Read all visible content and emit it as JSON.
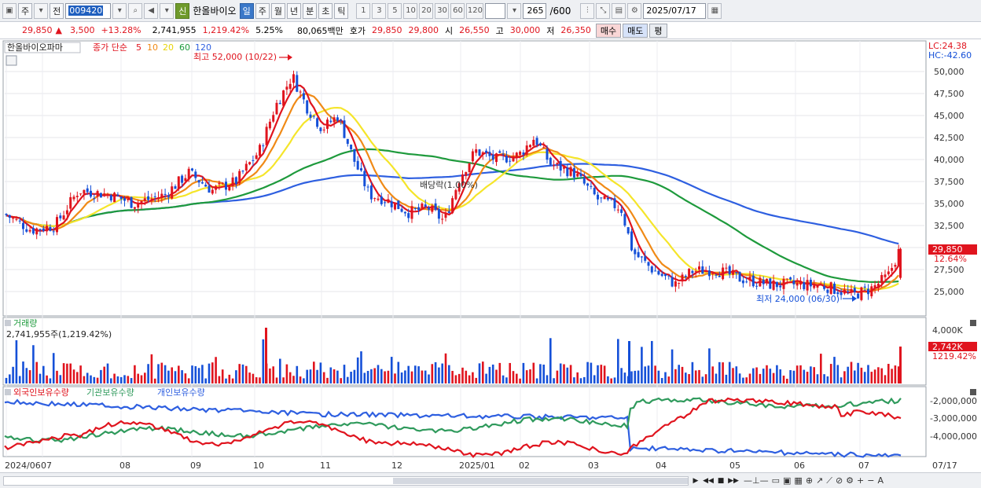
{
  "toolbar": {
    "type_label": "주",
    "prev_label": "전",
    "code_value": "009420",
    "sin_badge": "신",
    "stock_name": "한올바이오",
    "periods": [
      "일",
      "주",
      "월",
      "년",
      "분",
      "초",
      "틱"
    ],
    "active_period": "일",
    "intervals": [
      "1",
      "3",
      "5",
      "10",
      "20",
      "30",
      "60",
      "120"
    ],
    "count_value": "265",
    "count_total": "/600",
    "date_value": "2025/07/17"
  },
  "quote": {
    "price": "29,850",
    "change_arrow": "▲",
    "change": "3,500",
    "change_pct": "+13.28%",
    "volume": "2,741,955",
    "volume_ratio": "1,219.42%",
    "turnover_pct": "5.25%",
    "amount": "80,065백만",
    "ask_label": "호가",
    "ask": "29,850",
    "bid": "29,800",
    "open_label": "시",
    "open": "26,550",
    "high_label": "고",
    "high": "30,000",
    "low_label": "저",
    "low": "26,350",
    "buy_label": "매수",
    "sell_label": "매도",
    "eval_label": "평"
  },
  "price_panel": {
    "stock_label": "한올바이오파마",
    "ma_label": "종가 단순",
    "ma_periods": [
      "5",
      "10",
      "20",
      "60",
      "120"
    ],
    "lc_label": "LC:24.38",
    "hc_label": "HC:-42.60",
    "max_label": "최고 52,000 (10/22)",
    "min_label": "최저 24,000 (06/30)",
    "dividend_label": "배당락(1.00%)",
    "current_price_tag": "29,850",
    "current_pct_tag": "12.64%",
    "y_ticks": [
      "50,000",
      "47,500",
      "45,000",
      "42,500",
      "40,000",
      "37,500",
      "35,000",
      "32,500",
      "30,000",
      "27,500",
      "25,000"
    ]
  },
  "volume_panel": {
    "title": "거래량",
    "value_label": "2,741,955주(1,219.42%)",
    "y_tick": "4,000K",
    "current_tag": "2,742K",
    "current_pct": "1219.42%"
  },
  "holdings_panel": {
    "legend": [
      "외국인보유수량",
      "기관보유수량",
      "개인보유수량"
    ],
    "y_ticks": [
      "-2,000,000",
      "-3,000,000",
      "-4,000,000"
    ]
  },
  "x_axis": {
    "labels": [
      "2024/06",
      "07",
      "08",
      "09",
      "10",
      "11",
      "12",
      "2025/01",
      "02",
      "03",
      "04",
      "05",
      "06",
      "07"
    ],
    "right_label": "07/17"
  },
  "colors": {
    "up": "#e0141e",
    "down": "#1550d8",
    "ma5": "#e0141e",
    "ma10": "#f08a16",
    "ma20": "#f5e52a",
    "ma60": "#1e9a3c",
    "ma120": "#2e5fe0",
    "foreign": "#e0141e",
    "institution": "#2f9a5c",
    "individual": "#2e5fe0"
  }
}
